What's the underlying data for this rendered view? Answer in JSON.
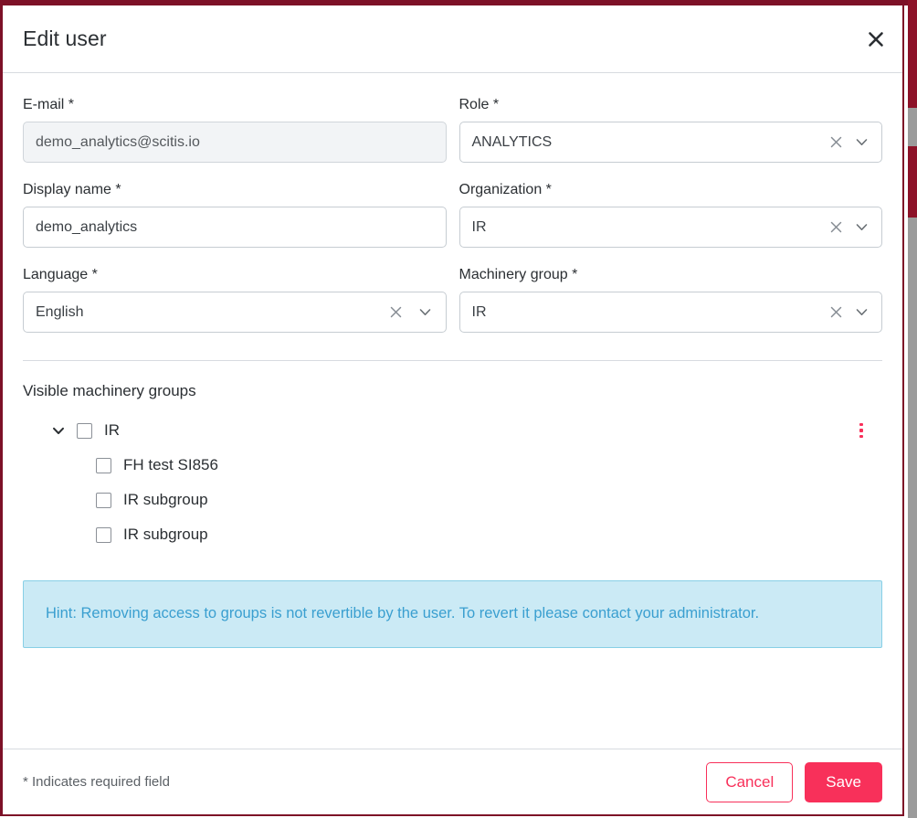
{
  "modal": {
    "title": "Edit user",
    "close_icon": "close-icon"
  },
  "form": {
    "email": {
      "label": "E-mail *",
      "value": "demo_analytics@scitis.io",
      "disabled": true
    },
    "role": {
      "label": "Role *",
      "value": "ANALYTICS",
      "clear_icon": "clear-icon",
      "chevron_icon": "chevron-down-icon"
    },
    "display_name": {
      "label": "Display name *",
      "value": "demo_analytics"
    },
    "organization": {
      "label": "Organization *",
      "value": "IR",
      "clear_icon": "clear-icon",
      "chevron_icon": "chevron-down-icon"
    },
    "language": {
      "label": "Language *",
      "value": "English",
      "clear_icon": "clear-icon",
      "chevron_icon": "chevron-down-icon"
    },
    "machinery_group": {
      "label": "Machinery group *",
      "value": "IR",
      "clear_icon": "clear-icon",
      "chevron_icon": "chevron-down-icon"
    }
  },
  "tree": {
    "title": "Visible machinery groups",
    "parent": {
      "label": "IR",
      "checked": false,
      "expanded": true,
      "caret_icon": "chevron-down-icon",
      "menu_icon": "more-vertical-icon"
    },
    "children": [
      {
        "label": "FH test SI856",
        "checked": false
      },
      {
        "label": "IR subgroup",
        "checked": false
      },
      {
        "label": "IR subgroup",
        "checked": false
      }
    ]
  },
  "hint": {
    "text": "Hint: Removing access to groups is not revertible by the user. To revert it please contact your administrator."
  },
  "footer": {
    "required_note": "* Indicates required field",
    "cancel_label": "Cancel",
    "save_label": "Save"
  },
  "colors": {
    "accent": "#f8305a",
    "app_header": "#8d1228",
    "hint_bg": "#cbeaf5",
    "hint_border": "#87cfe6",
    "hint_text": "#3a9fd0",
    "border": "#c6ccd2"
  }
}
